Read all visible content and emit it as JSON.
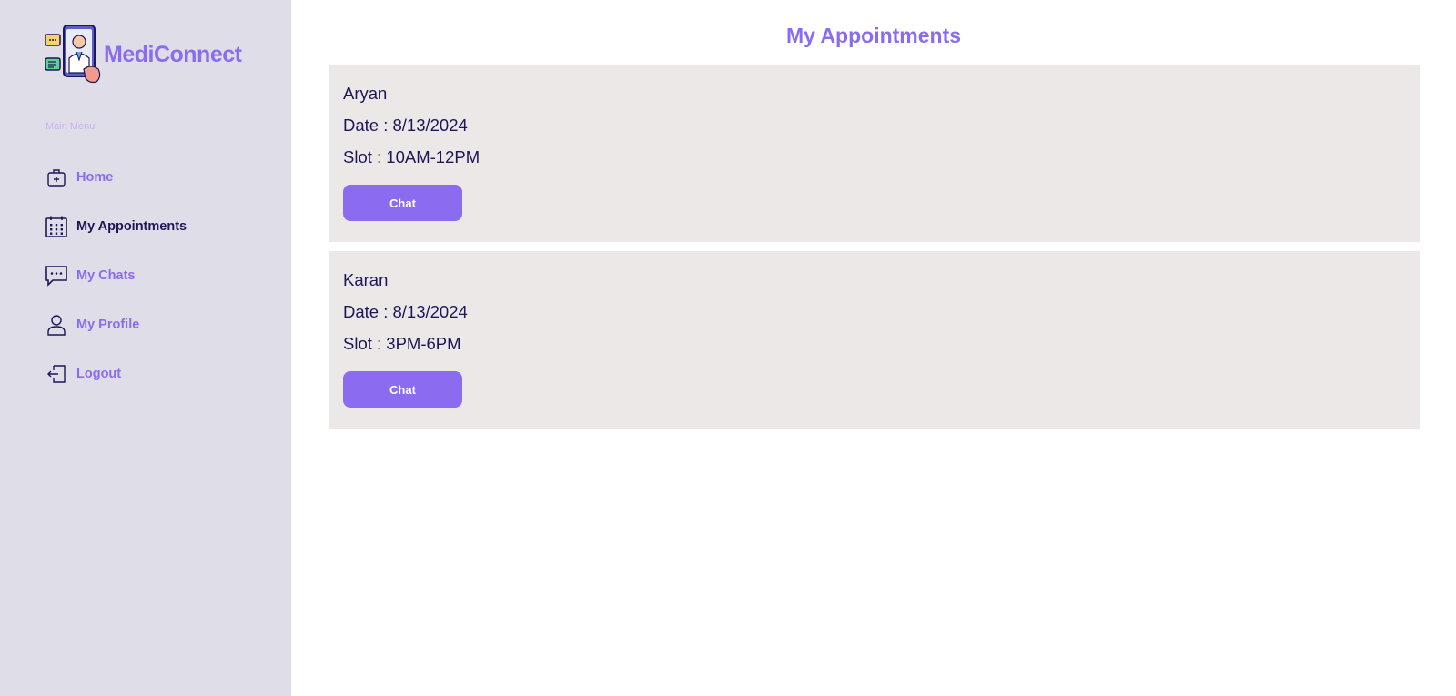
{
  "brand": {
    "name": "MediConnect",
    "logo_icon": "doctor-phone-logo-icon"
  },
  "sidebar": {
    "menu_label": "Main Menu",
    "items": [
      {
        "label": "Home",
        "icon": "medical-bag-icon",
        "active": false
      },
      {
        "label": "My Appointments",
        "icon": "calendar-icon",
        "active": true
      },
      {
        "label": "My Chats",
        "icon": "chat-bubble-icon",
        "active": false
      },
      {
        "label": "My Profile",
        "icon": "user-icon",
        "active": false
      },
      {
        "label": "Logout",
        "icon": "logout-icon",
        "active": false
      }
    ]
  },
  "main": {
    "title": "My Appointments",
    "appointments": [
      {
        "name": "Aryan",
        "date": "Date : 8/13/2024",
        "slot": "Slot : 10AM-12PM",
        "button": "Chat"
      },
      {
        "name": "Karan",
        "date": "Date : 8/13/2024",
        "slot": "Slot : 3PM-6PM",
        "button": "Chat"
      }
    ]
  },
  "colors": {
    "accent": "#8b6cf0",
    "sidebar_bg": "#dfdee8",
    "card_bg": "#ece8e8",
    "text_dark": "#1e1656",
    "menu_label": "#c9b2f3"
  }
}
